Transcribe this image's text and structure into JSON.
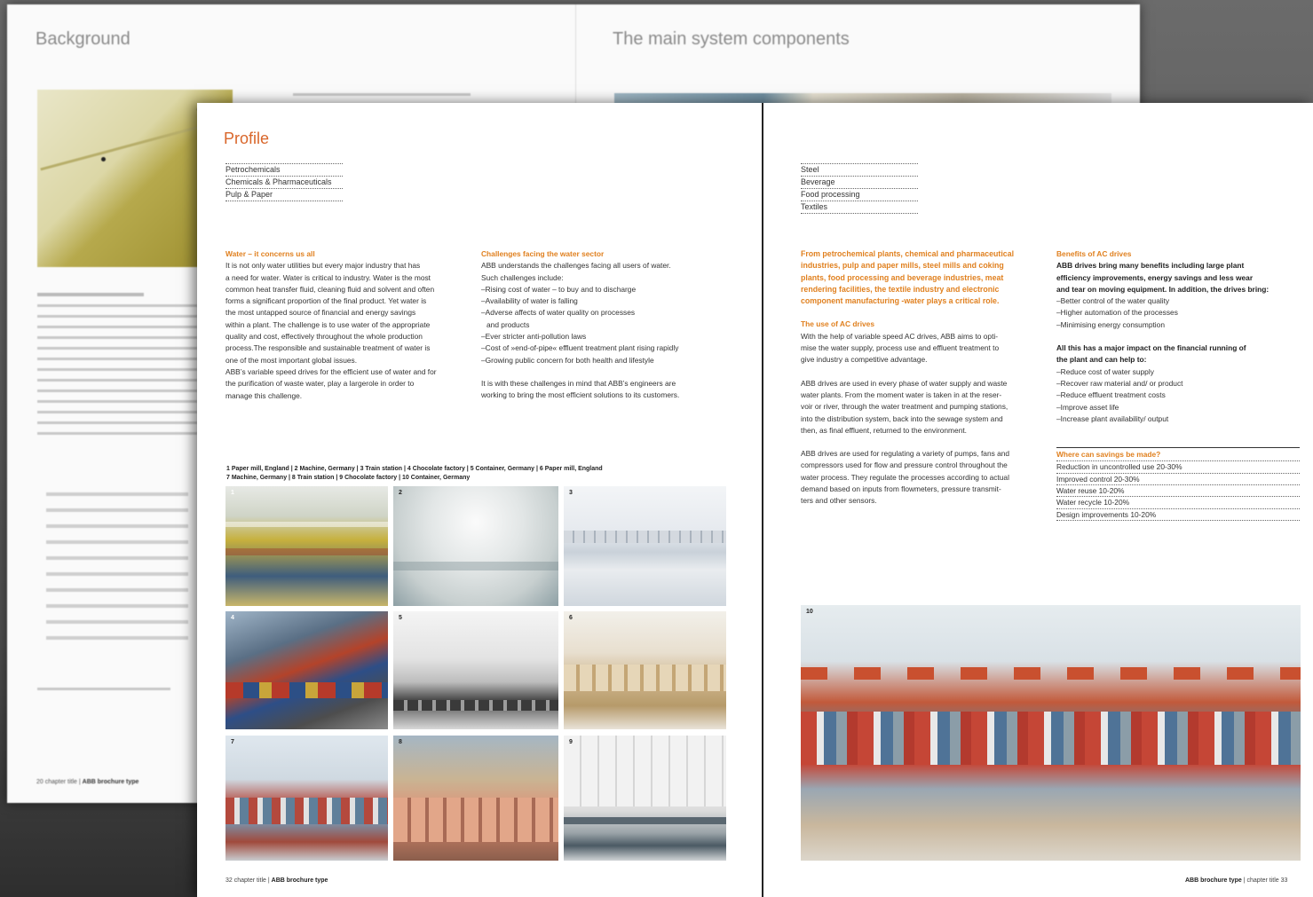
{
  "background_spread": {
    "left_title": "Background",
    "right_title": "The main system components",
    "footer_page": "20",
    "footer_chapter": "chapter title",
    "footer_brand": "ABB brochure type"
  },
  "profile": {
    "title": "Profile"
  },
  "industries_left": [
    "Petrochemicals",
    "Chemicals & Pharmaceuticals",
    "Pulp & Paper"
  ],
  "industries_right": [
    "Steel",
    "Beverage",
    "Food processing",
    "Textiles"
  ],
  "water_section": {
    "heading": "Water – it concerns us all",
    "lines": [
      "It is not only water utilities but every major industry that has",
      "a need for water. Water is critical to industry. Water is the most",
      "common heat transfer fluid, cleaning fluid and solvent and often",
      "forms a significant proportion of the final product. Yet water is",
      "the most untapped source of financial and energy savings",
      "within a plant. The challenge is to use water of the appropriate",
      "quality and cost, effectively throughout the whole production",
      "process.The responsible and sustainable treatment of water is",
      "one of the most important global issues.",
      "ABB’s variable speed drives for the efficient use of water and for",
      "the purification of waste water, play a largerole in order to",
      "manage this challenge."
    ]
  },
  "challenges_section": {
    "heading": "Challenges facing the water sector",
    "intro_lines": [
      "ABB understands the challenges facing all users of water.",
      "Such challenges include:"
    ],
    "bullets": [
      "Rising cost of water – to buy and to discharge",
      "Availability of water is falling",
      "Adverse affects of water quality on processes",
      "and products",
      "Ever stricter anti-pollution laws",
      "Cost of »end-of-pipe« effluent treatment plant rising rapidly",
      "Growing public concern for both health and lifestyle"
    ],
    "closing_lines": [
      "It is with these challenges in mind that ABB’s engineers are",
      "working to bring the most efficient solutions to its customers."
    ]
  },
  "photo_legend": {
    "line1": "1  Paper mill, England  |  2  Machine, Germany    |  3  Train station  |  4  Chocolate factory  |  5  Container, Germany    |  6  Paper mill, England",
    "line2": "7  Machine, Germany    |  8  Train station  |  9  Chocolate factory  |  10  Container, Germany"
  },
  "photos": [
    {
      "num": "1"
    },
    {
      "num": "2"
    },
    {
      "num": "3"
    },
    {
      "num": "4"
    },
    {
      "num": "5"
    },
    {
      "num": "6"
    },
    {
      "num": "7"
    },
    {
      "num": "8"
    },
    {
      "num": "9"
    },
    {
      "num": "10"
    }
  ],
  "intro_section": {
    "lead_lines": [
      "From petrochemical plants, chemical and pharmaceutical",
      "industries, pulp and paper mills, steel mills and coking",
      "plants, food processing and beverage industries, meat",
      "rendering facilities, the textile industry and electronic",
      "component manufacturing -water plays a critical role."
    ],
    "ac_heading": "The use of AC drives",
    "ac_para1": [
      "With the help of variable speed AC drives, ABB aims to opti-",
      "mise the water supply, process use and effluent treatment to",
      "give industry a competitive advantage."
    ],
    "ac_para2": [
      "ABB drives are used in every phase of water supply and waste",
      "water plants. From the moment water is taken in at the reser-",
      "voir or river, through the water treatment and pumping stations,",
      "into the distribution system, back into the sewage system and",
      "then, as final effluent, returned to the environment."
    ],
    "ac_para3": [
      "ABB drives are used for regulating a variety of pumps, fans and",
      "compressors used for flow and pressure control throughout the",
      "water process. They regulate the processes according to actual",
      "demand based on inputs from flowmeters, pressure transmit-",
      "ters and other sensors."
    ]
  },
  "benefits_section": {
    "heading": "Benefits of AC drives",
    "bold_lines": [
      "ABB drives bring many benefits including large plant",
      "efficiency improvements, energy savings and less wear",
      "and tear on moving equipment. In addition, the drives bring:"
    ],
    "bullets": [
      "Better control of the water quality",
      "Higher automation of the processes",
      "Minimising energy consumption"
    ],
    "impact_bold_lines": [
      "All this has a major impact on the financial running of",
      "the plant and can help to:"
    ],
    "impact_bullets": [
      "Reduce cost of water supply",
      "Recover raw material and/ or product",
      "Reduce effluent treatment costs",
      "Improve asset life",
      "Increase plant availability/ output"
    ]
  },
  "savings": {
    "title": "Where can savings be made?",
    "items": [
      "Reduction in uncontrolled use 20-30%",
      "Improved control 20-30%",
      "Water reuse 10-20%",
      "Water recycle 10-20%",
      "Design improvements 10-20%"
    ]
  },
  "footer_left": {
    "page": "32",
    "chapter": "chapter title",
    "brand": "ABB brochure type"
  },
  "footer_right": {
    "brand": "ABB brochure type",
    "chapter": "chapter title",
    "page": "33"
  },
  "colors": {
    "accent": "#e0801f",
    "title": "#d9662a"
  }
}
